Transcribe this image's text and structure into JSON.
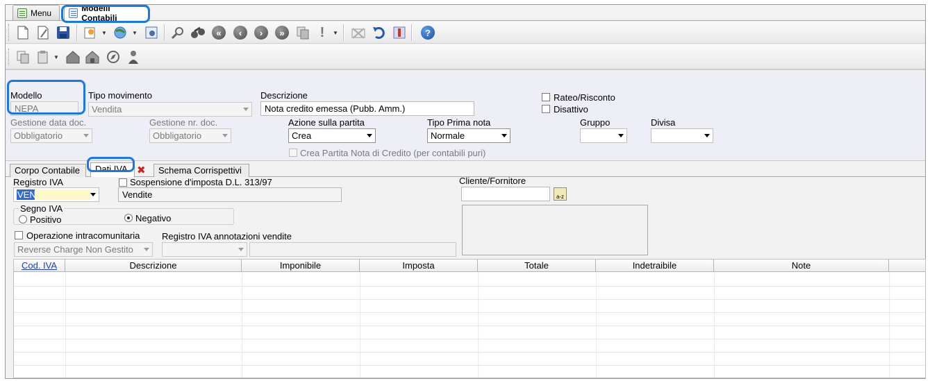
{
  "tabs": [
    {
      "label": "Menu",
      "icon": "menu-tree-icon"
    },
    {
      "label": "Modelli Contabili",
      "icon": "ledger-icon"
    }
  ],
  "toolbar1": {
    "icons": [
      "new-document-icon",
      "edit-icon",
      "save-icon",
      "wizard-icon",
      "globe-icon",
      "settings-icon",
      "search-icon",
      "binoculars-icon",
      "first-icon",
      "previous-icon",
      "next-icon",
      "last-icon",
      "copy-icon",
      "alert-icon",
      "cancel-icon",
      "undo-icon",
      "bookmark-icon",
      "help-icon"
    ],
    "help_glyph": "?",
    "alert_glyph": "!"
  },
  "toolbar2": {
    "icons": [
      "copy-doc-icon",
      "clipboard-icon",
      "house-icon",
      "house2-icon",
      "compass-icon",
      "user-icon"
    ]
  },
  "form": {
    "modello": {
      "label": "Modello",
      "value": "NEPA"
    },
    "tipo_movimento": {
      "label": "Tipo movimento",
      "value": "Vendita"
    },
    "descrizione": {
      "label": "Descrizione",
      "value": "Nota credito emessa (Pubb. Amm.)"
    },
    "rateo_risconto": {
      "label": "Rateo/Risconto",
      "checked": false
    },
    "disattivo": {
      "label": "Disattivo",
      "checked": false
    },
    "gestione_data": {
      "label": "Gestione data doc.",
      "value": "Obbligatorio"
    },
    "gestione_nr": {
      "label": "Gestione nr. doc.",
      "value": "Obbligatorio"
    },
    "azione_partita": {
      "label": "Azione sulla partita",
      "value": "Crea"
    },
    "tipo_prima_nota": {
      "label": "Tipo Prima nota",
      "value": "Normale"
    },
    "gruppo": {
      "label": "Gruppo",
      "value": ""
    },
    "divisa": {
      "label": "Divisa",
      "value": ""
    },
    "crea_partita": {
      "label": "Crea Partita Nota di Credito (per contabili puri)",
      "checked": false
    }
  },
  "inner_tabs": [
    "Corpo Contabile",
    "Dati IVA",
    "Schema Corrispettivi"
  ],
  "iva": {
    "registro": {
      "label": "Registro IVA",
      "value": "VEN"
    },
    "sospensione": {
      "label": "Sospensione d'imposta D.L. 313/97",
      "checked": false
    },
    "registro_desc": "Vendite",
    "cliente": {
      "label": "Cliente/Fornitore",
      "value": "",
      "lookup": "a-z"
    },
    "segno": {
      "label": "Segno IVA",
      "positivo": "Positivo",
      "negativo": "Negativo",
      "selected": "Negativo"
    },
    "intracom": {
      "label": "Operazione intracomunitaria",
      "checked": false
    },
    "reverse_charge": "Reverse Charge Non Gestito",
    "registro_annot": {
      "label": "Registro IVA annotazioni vendite",
      "value": ""
    }
  },
  "grid": {
    "columns": [
      "Cod. IVA",
      "Descrizione",
      "Imponibile",
      "Imposta",
      "Totale",
      "Indetraibile",
      "Note"
    ],
    "rows": []
  },
  "colors": {
    "highlight": "#1a78e6",
    "form_bg": "#eeeff6",
    "link": "#1a3fc4"
  }
}
